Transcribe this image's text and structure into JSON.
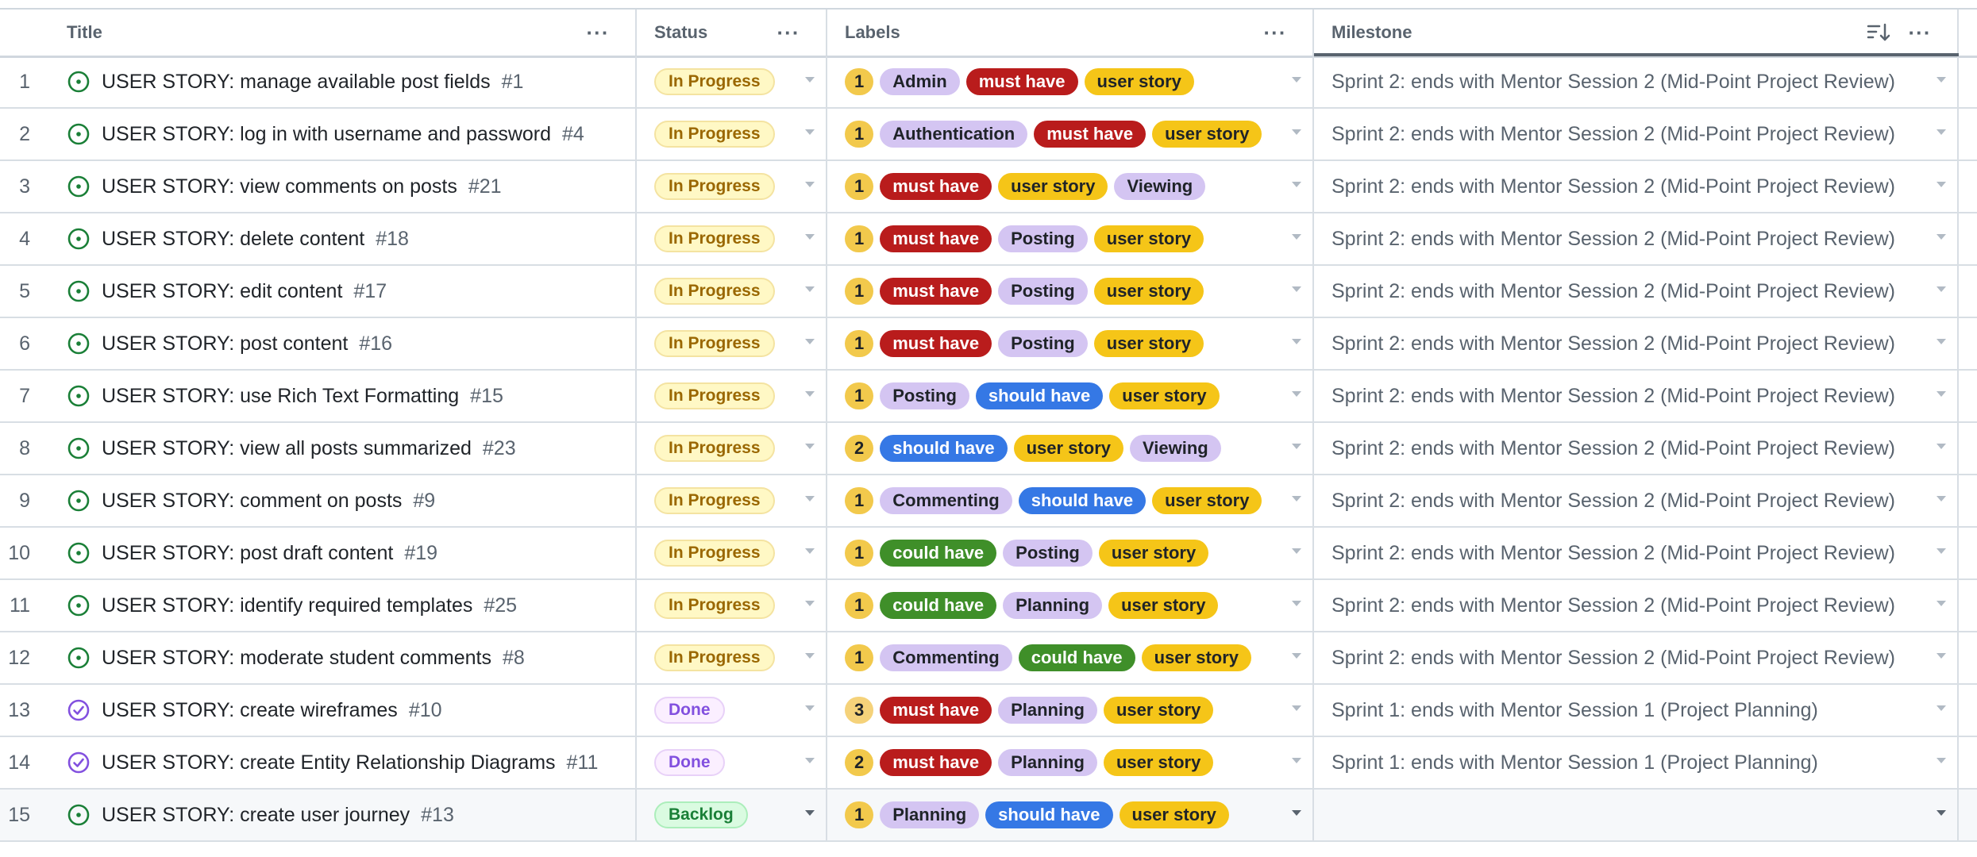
{
  "columns": {
    "title": "Title",
    "status": "Status",
    "labels": "Labels",
    "milestone": "Milestone",
    "menu_glyph": "···"
  },
  "label_colors": {
    "1": {
      "bg": "#f2c94c",
      "fg": "#1f2328"
    },
    "2": {
      "bg": "#f2c94c",
      "fg": "#1f2328"
    },
    "3": {
      "bg": "#f5d27a",
      "fg": "#1f2328"
    },
    "Admin": {
      "bg": "#d4c5f2",
      "fg": "#1f2328"
    },
    "Authentication": {
      "bg": "#d4c5f2",
      "fg": "#1f2328"
    },
    "Viewing": {
      "bg": "#d4c5f2",
      "fg": "#1f2328"
    },
    "Posting": {
      "bg": "#d4c5f2",
      "fg": "#1f2328"
    },
    "Commenting": {
      "bg": "#d4c5f2",
      "fg": "#1f2328"
    },
    "Planning": {
      "bg": "#d4c5f2",
      "fg": "#1f2328"
    },
    "must have": {
      "bg": "#b91c1c",
      "fg": "#ffffff"
    },
    "should have": {
      "bg": "#3578e5",
      "fg": "#ffffff"
    },
    "could have": {
      "bg": "#3f8f29",
      "fg": "#ffffff"
    },
    "user story": {
      "bg": "#f5c518",
      "fg": "#1f2328"
    }
  },
  "rows": [
    {
      "n": "1",
      "title": "USER STORY: manage available post fields",
      "issue": "#1",
      "icon": "open-issue-icon",
      "status": "In Progress",
      "labels": [
        "1",
        "Admin",
        "must have",
        "user story"
      ],
      "milestone": "Sprint 2: ends with Mentor Session 2 (Mid-Point Project Review)"
    },
    {
      "n": "2",
      "title": "USER STORY: log in with username and password",
      "issue": "#4",
      "icon": "open-issue-icon",
      "status": "In Progress",
      "labels": [
        "1",
        "Authentication",
        "must have",
        "user story"
      ],
      "milestone": "Sprint 2: ends with Mentor Session 2 (Mid-Point Project Review)"
    },
    {
      "n": "3",
      "title": "USER STORY: view comments on posts",
      "issue": "#21",
      "icon": "open-issue-icon",
      "status": "In Progress",
      "labels": [
        "1",
        "must have",
        "user story",
        "Viewing"
      ],
      "milestone": "Sprint 2: ends with Mentor Session 2 (Mid-Point Project Review)"
    },
    {
      "n": "4",
      "title": "USER STORY: delete content",
      "issue": "#18",
      "icon": "open-issue-icon",
      "status": "In Progress",
      "labels": [
        "1",
        "must have",
        "Posting",
        "user story"
      ],
      "milestone": "Sprint 2: ends with Mentor Session 2 (Mid-Point Project Review)"
    },
    {
      "n": "5",
      "title": "USER STORY: edit content",
      "issue": "#17",
      "icon": "open-issue-icon",
      "status": "In Progress",
      "labels": [
        "1",
        "must have",
        "Posting",
        "user story"
      ],
      "milestone": "Sprint 2: ends with Mentor Session 2 (Mid-Point Project Review)"
    },
    {
      "n": "6",
      "title": "USER STORY: post content",
      "issue": "#16",
      "icon": "open-issue-icon",
      "status": "In Progress",
      "labels": [
        "1",
        "must have",
        "Posting",
        "user story"
      ],
      "milestone": "Sprint 2: ends with Mentor Session 2 (Mid-Point Project Review)"
    },
    {
      "n": "7",
      "title": "USER STORY: use Rich Text Formatting",
      "issue": "#15",
      "icon": "open-issue-icon",
      "status": "In Progress",
      "labels": [
        "1",
        "Posting",
        "should have",
        "user story"
      ],
      "milestone": "Sprint 2: ends with Mentor Session 2 (Mid-Point Project Review)"
    },
    {
      "n": "8",
      "title": "USER STORY: view all posts summarized",
      "issue": "#23",
      "icon": "open-issue-icon",
      "status": "In Progress",
      "labels": [
        "2",
        "should have",
        "user story",
        "Viewing"
      ],
      "milestone": "Sprint 2: ends with Mentor Session 2 (Mid-Point Project Review)"
    },
    {
      "n": "9",
      "title": "USER STORY: comment on posts",
      "issue": "#9",
      "icon": "open-issue-icon",
      "status": "In Progress",
      "labels": [
        "1",
        "Commenting",
        "should have",
        "user story"
      ],
      "milestone": "Sprint 2: ends with Mentor Session 2 (Mid-Point Project Review)"
    },
    {
      "n": "10",
      "title": "USER STORY: post draft content",
      "issue": "#19",
      "icon": "open-issue-icon",
      "status": "In Progress",
      "labels": [
        "1",
        "could have",
        "Posting",
        "user story"
      ],
      "milestone": "Sprint 2: ends with Mentor Session 2 (Mid-Point Project Review)"
    },
    {
      "n": "11",
      "title": "USER STORY: identify required templates",
      "issue": "#25",
      "icon": "open-issue-icon",
      "status": "In Progress",
      "labels": [
        "1",
        "could have",
        "Planning",
        "user story"
      ],
      "milestone": "Sprint 2: ends with Mentor Session 2 (Mid-Point Project Review)"
    },
    {
      "n": "12",
      "title": "USER STORY: moderate student comments",
      "issue": "#8",
      "icon": "open-issue-icon",
      "status": "In Progress",
      "labels": [
        "1",
        "Commenting",
        "could have",
        "user story"
      ],
      "milestone": "Sprint 2: ends with Mentor Session 2 (Mid-Point Project Review)"
    },
    {
      "n": "13",
      "title": "USER STORY: create wireframes",
      "issue": "#10",
      "icon": "closed-issue-icon",
      "status": "Done",
      "labels": [
        "3",
        "must have",
        "Planning",
        "user story"
      ],
      "milestone": "Sprint 1: ends with Mentor Session 1 (Project Planning)"
    },
    {
      "n": "14",
      "title": "USER STORY: create Entity Relationship Diagrams",
      "issue": "#11",
      "icon": "closed-issue-icon",
      "status": "Done",
      "labels": [
        "2",
        "must have",
        "Planning",
        "user story"
      ],
      "milestone": "Sprint 1: ends with Mentor Session 1 (Project Planning)"
    },
    {
      "n": "15",
      "title": "USER STORY: create user journey",
      "issue": "#13",
      "icon": "open-issue-icon",
      "status": "Backlog",
      "labels": [
        "1",
        "Planning",
        "should have",
        "user story"
      ],
      "milestone": ""
    }
  ]
}
